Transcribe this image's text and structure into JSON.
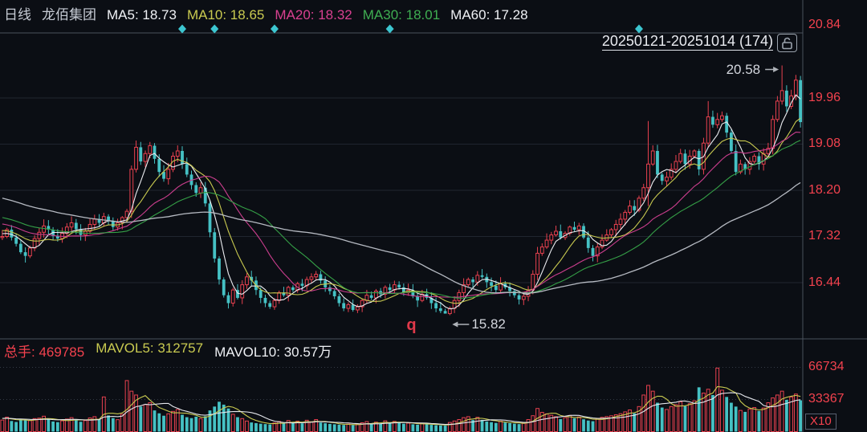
{
  "header": {
    "period": "日线",
    "stock_name": "龙佰集团",
    "ma5": "MA5: 18.73",
    "ma10": "MA10: 18.65",
    "ma20": "MA20: 18.32",
    "ma30": "MA30: 18.01",
    "ma60": "MA60: 17.28"
  },
  "range_selector": {
    "label": "20250121-20251014 (174)"
  },
  "price_axis": {
    "labels": [
      "20.84",
      "19.96",
      "19.08",
      "18.20",
      "17.32",
      "16.44"
    ],
    "values": [
      20.84,
      19.96,
      19.08,
      18.2,
      17.32,
      16.44
    ]
  },
  "volume_axis": {
    "labels": [
      "66734",
      "33367"
    ],
    "values": [
      66734,
      33367
    ],
    "scale_label": "X10"
  },
  "volume_header": {
    "vol": "总手: 469785",
    "mavol5": "MAVOL5: 312757",
    "mavol10": "MAVOL10: 30.57万"
  },
  "annotations": {
    "high": {
      "text": "20.58",
      "bar": 169,
      "price": 20.58
    },
    "low": {
      "text": "15.82",
      "bar": 97,
      "price": 15.82
    },
    "q_marker": {
      "text": "q",
      "bar": 89
    }
  },
  "event_marker_bars": [
    39,
    46,
    59,
    84,
    138
  ],
  "colors": {
    "background": "#0b0e14",
    "up": "#e8414f",
    "down": "#45c1c4",
    "axis_text": "#f3424e",
    "ma5": "#ecedf1",
    "ma10": "#c9ca50",
    "ma20": "#cc3e8e",
    "ma30": "#35a047",
    "ma60": "#b6bac2",
    "mavol5": "#c9ca50",
    "mavol10": "#e4e6eb",
    "diamond": "#3cc6d0",
    "grid": "#20252f",
    "frame": "#4a515c"
  },
  "chart_data": {
    "type": "candlestick",
    "date_range": "20250121-20251014",
    "bar_count": 174,
    "open_first": 17.3,
    "closes": [
      17.32,
      17.45,
      17.3,
      17.18,
      17.02,
      16.95,
      17.1,
      17.28,
      17.4,
      17.52,
      17.45,
      17.33,
      17.28,
      17.38,
      17.5,
      17.58,
      17.46,
      17.35,
      17.42,
      17.55,
      17.65,
      17.58,
      17.7,
      17.62,
      17.5,
      17.58,
      17.68,
      17.8,
      18.6,
      19.02,
      18.75,
      18.9,
      19.05,
      18.8,
      18.55,
      18.42,
      18.6,
      18.85,
      18.95,
      18.7,
      18.5,
      18.3,
      18.15,
      18.25,
      17.95,
      17.4,
      16.9,
      16.5,
      16.2,
      16.05,
      16.3,
      16.15,
      16.4,
      16.55,
      16.48,
      16.3,
      16.15,
      16.05,
      15.98,
      16.1,
      16.25,
      16.2,
      16.35,
      16.3,
      16.42,
      16.38,
      16.5,
      16.55,
      16.6,
      16.48,
      16.35,
      16.28,
      16.18,
      16.05,
      15.95,
      16.02,
      15.92,
      15.98,
      16.1,
      16.2,
      16.15,
      16.28,
      16.22,
      16.35,
      16.3,
      16.4,
      16.35,
      16.25,
      16.3,
      16.18,
      16.1,
      16.22,
      16.15,
      16.05,
      15.95,
      15.9,
      15.85,
      15.95,
      16.1,
      16.25,
      16.4,
      16.5,
      16.45,
      16.58,
      16.55,
      16.45,
      16.38,
      16.3,
      16.42,
      16.35,
      16.28,
      16.2,
      16.12,
      16.18,
      16.3,
      16.6,
      17.0,
      17.12,
      17.25,
      17.35,
      17.42,
      17.3,
      17.38,
      17.5,
      17.45,
      17.52,
      17.3,
      17.1,
      16.95,
      17.12,
      17.25,
      17.35,
      17.45,
      17.55,
      17.65,
      17.78,
      17.9,
      17.82,
      18.05,
      18.25,
      18.7,
      18.95,
      18.5,
      18.38,
      18.45,
      18.6,
      18.75,
      18.9,
      18.7,
      18.85,
      18.95,
      18.6,
      19.1,
      19.6,
      19.45,
      19.55,
      19.62,
      19.3,
      18.95,
      18.55,
      18.7,
      18.6,
      18.75,
      18.85,
      18.7,
      18.9,
      19.0,
      19.55,
      19.9,
      20.1,
      19.8,
      20.0,
      20.3,
      19.5
    ],
    "volumes": [
      12000,
      15000,
      11000,
      10000,
      13000,
      12000,
      11500,
      13500,
      14000,
      16000,
      12500,
      10500,
      9800,
      11200,
      13000,
      14500,
      11800,
      10200,
      11500,
      14200,
      15500,
      12800,
      36000,
      16800,
      14000,
      12400,
      18000,
      53000,
      42000,
      38000,
      26000,
      28000,
      30000,
      22000,
      19000,
      16500,
      18500,
      21000,
      23000,
      17500,
      15000,
      14000,
      15500,
      13500,
      16000,
      22000,
      26000,
      31000,
      28000,
      24000,
      18000,
      15000,
      13500,
      11000,
      9500,
      8800,
      8200,
      7800,
      7500,
      9000,
      10500,
      8500,
      11500,
      9200,
      10800,
      8600,
      11800,
      10200,
      12500,
      9400,
      8700,
      8000,
      7600,
      7200,
      6900,
      7800,
      6800,
      7400,
      9200,
      10400,
      8200,
      9800,
      8400,
      11200,
      9000,
      10600,
      9600,
      8200,
      8800,
      7600,
      7200,
      8600,
      7800,
      7000,
      6600,
      6400,
      6200,
      9500,
      11000,
      12500,
      14500,
      15500,
      12000,
      14800,
      12200,
      10500,
      9800,
      9000,
      10800,
      9400,
      8800,
      8200,
      7800,
      8600,
      12500,
      16500,
      24000,
      20000,
      18500,
      17000,
      15500,
      13000,
      14500,
      16800,
      13800,
      15200,
      12800,
      11500,
      10800,
      13500,
      14800,
      15600,
      16400,
      17500,
      18600,
      20500,
      22500,
      19000,
      26000,
      38000,
      48000,
      42000,
      30000,
      25000,
      23000,
      26000,
      28000,
      31000,
      26500,
      29000,
      32000,
      46000,
      40000,
      44000,
      38000,
      66000,
      43000,
      36000,
      30000,
      26000,
      22000,
      20500,
      23500,
      25000,
      21500,
      24500,
      30000,
      35000,
      38000,
      42000,
      33000,
      36000,
      39000,
      32500
    ],
    "wick_overrides": {
      "97": {
        "low": 15.82
      },
      "140": {
        "high": 19.52,
        "low": 17.9
      },
      "153": {
        "high": 19.9
      },
      "169": {
        "high": 20.58
      }
    },
    "ma_periods": [
      5,
      10,
      20,
      30,
      60
    ],
    "mavol_periods": [
      5,
      10
    ],
    "legend_position": "top-left",
    "grid": true
  }
}
